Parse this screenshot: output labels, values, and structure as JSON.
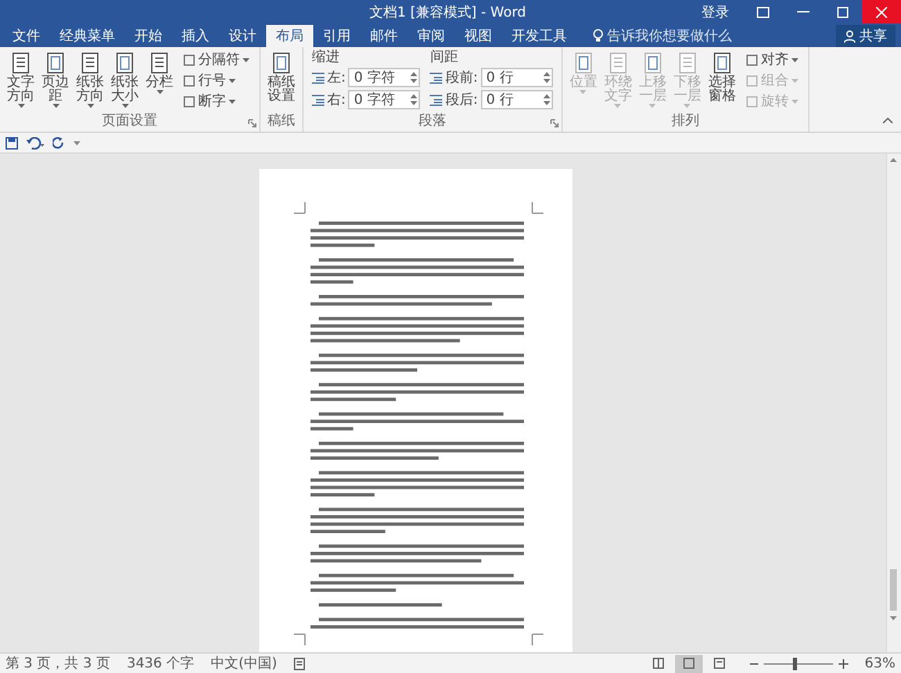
{
  "window": {
    "title": "文档1 [兼容模式] - Word",
    "sign_in": "登录"
  },
  "tabs": [
    {
      "label": "文件",
      "selected": false
    },
    {
      "label": "经典菜单",
      "selected": false
    },
    {
      "label": "开始",
      "selected": false
    },
    {
      "label": "插入",
      "selected": false
    },
    {
      "label": "设计",
      "selected": false
    },
    {
      "label": "布局",
      "selected": true
    },
    {
      "label": "引用",
      "selected": false
    },
    {
      "label": "邮件",
      "selected": false
    },
    {
      "label": "审阅",
      "selected": false
    },
    {
      "label": "视图",
      "selected": false
    },
    {
      "label": "开发工具",
      "selected": false
    }
  ],
  "search": {
    "placeholder": "告诉我你想要做什么"
  },
  "share": "共享",
  "ribbon": {
    "groups": [
      {
        "kind": "buttons",
        "label": "页面设置",
        "launcher": true,
        "large": [
          {
            "label": "文字方向",
            "menu": true,
            "disabled": false
          },
          {
            "label": "页边距",
            "menu": true,
            "disabled": false
          },
          {
            "label": "纸张方向",
            "menu": true,
            "disabled": false
          },
          {
            "label": "纸张大小",
            "menu": true,
            "disabled": false
          },
          {
            "label": "分栏",
            "menu": true,
            "disabled": false
          }
        ],
        "small": [
          {
            "label": "分隔符",
            "disabled": false
          },
          {
            "label": "行号",
            "disabled": false
          },
          {
            "label": "断字",
            "disabled": false
          }
        ]
      },
      {
        "kind": "buttons",
        "label": "稿纸",
        "launcher": false,
        "large": [
          {
            "label": "稿纸设置",
            "menu": false,
            "disabled": false
          }
        ]
      },
      {
        "kind": "paragraph",
        "label": "段落",
        "launcher": true,
        "columns": [
          {
            "title": "缩进",
            "rows": [
              {
                "label": "左:",
                "value": "0 字符"
              },
              {
                "label": "右:",
                "value": "0 字符"
              }
            ]
          },
          {
            "title": "间距",
            "rows": [
              {
                "label": "段前:",
                "value": "0 行"
              },
              {
                "label": "段后:",
                "value": "0 行"
              }
            ]
          }
        ]
      },
      {
        "kind": "buttons",
        "label": "排列",
        "launcher": false,
        "large": [
          {
            "label": "位置",
            "menu": true,
            "disabled": true
          },
          {
            "label": "环绕文字",
            "menu": true,
            "disabled": true
          },
          {
            "label": "上移一层",
            "menu": true,
            "disabled": true
          },
          {
            "label": "下移一层",
            "menu": true,
            "disabled": true
          },
          {
            "label": "选择窗格",
            "menu": false,
            "disabled": false
          }
        ],
        "small": [
          {
            "label": "对齐",
            "disabled": false
          },
          {
            "label": "组合",
            "disabled": true
          },
          {
            "label": "旋转",
            "disabled": true
          }
        ]
      }
    ]
  },
  "status_bar": {
    "page": "第 3 页，共 3 页",
    "words": "3436 个字",
    "language": "中文(中国)",
    "views": [
      {
        "selected": false
      },
      {
        "selected": true
      },
      {
        "selected": false
      }
    ],
    "zoom": {
      "level": 0.45,
      "reading": "63%"
    }
  }
}
